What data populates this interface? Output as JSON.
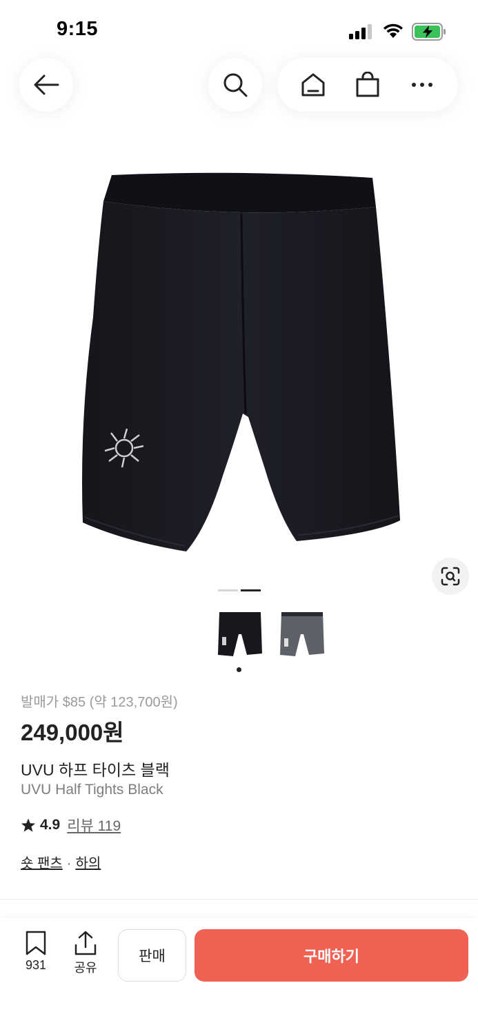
{
  "status_bar": {
    "time": "9:15"
  },
  "nav": {
    "back_icon": "arrow-left-icon",
    "search_icon": "search-icon",
    "home_icon": "home-icon",
    "bag_icon": "shopping-bag-icon",
    "more_icon": "more-horizontal-icon"
  },
  "product": {
    "release_price": "발매가 $85 (약 123,700원)",
    "price": "249,000원",
    "name_ko": "UVU 하프 타이츠 블랙",
    "name_en": "UVU Half Tights Black",
    "rating": "4.9",
    "reviews": "리뷰 119",
    "category_1": "숏 팬츠",
    "category_sep": "·",
    "category_2": "하의",
    "image_pager": {
      "total": 2,
      "current": 2
    },
    "thumbnails": [
      "black-tights-thumbnail",
      "grey-tights-thumbnail"
    ]
  },
  "bottom_bar": {
    "save_count": "931",
    "share_label": "공유",
    "sell_label": "판매",
    "buy_label": "구매하기"
  },
  "colors": {
    "accent": "#ef6253",
    "text_primary": "#222222",
    "text_muted": "#9a9a9a"
  }
}
